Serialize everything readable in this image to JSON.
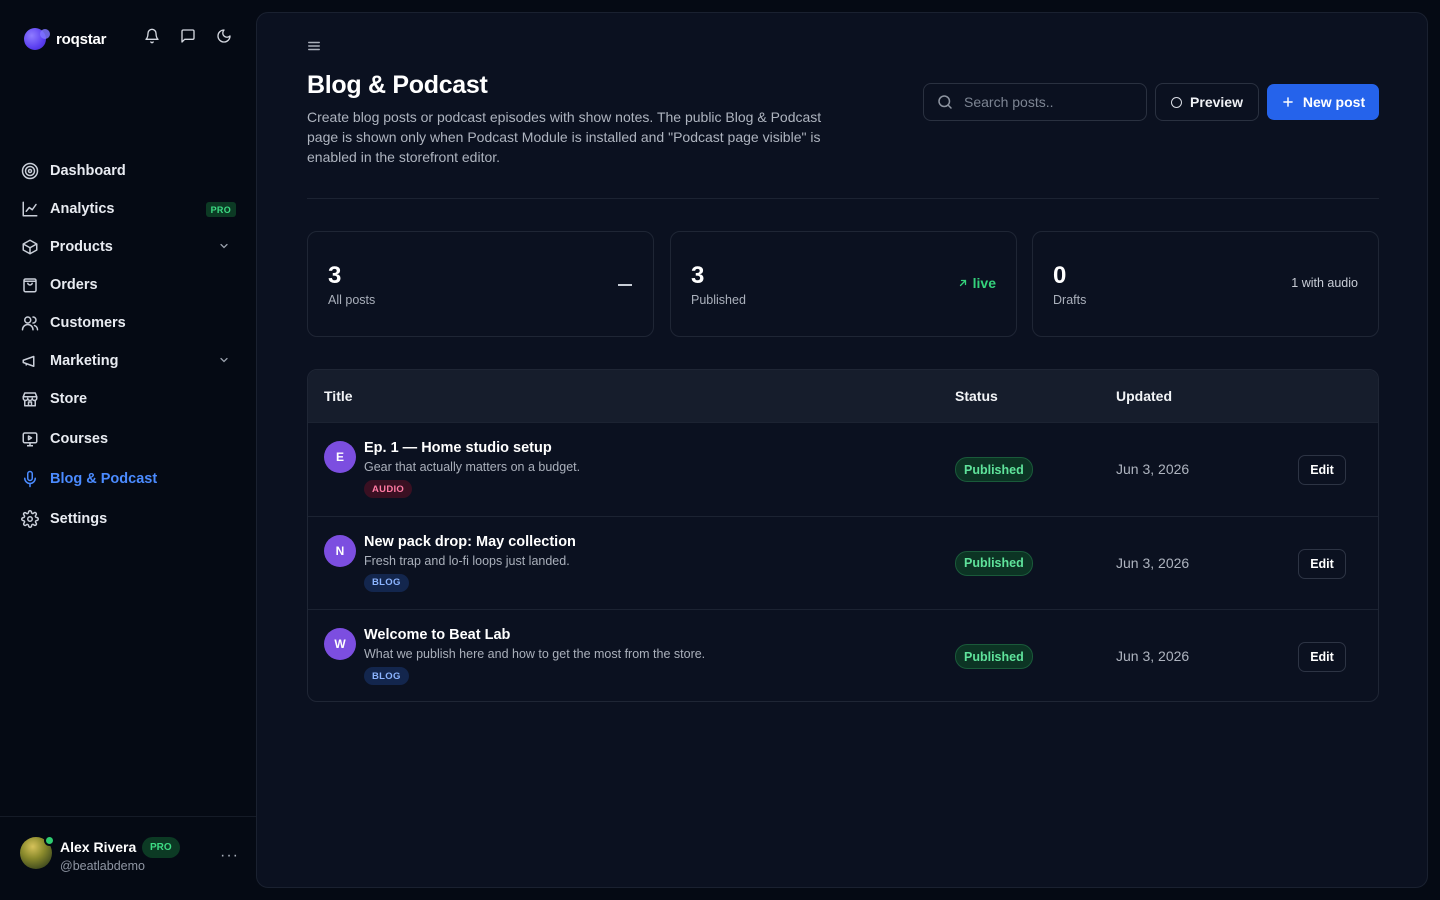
{
  "brand": {
    "name": "roqstar"
  },
  "nav": [
    {
      "label": "Dashboard",
      "icon": "target-icon",
      "active": false
    },
    {
      "label": "Analytics",
      "icon": "chart-line-icon",
      "badge": "PRO"
    },
    {
      "label": "Products",
      "icon": "box-icon",
      "expandable": true
    },
    {
      "label": "Orders",
      "icon": "shopping-bag-icon"
    },
    {
      "label": "Customers",
      "icon": "users-icon"
    },
    {
      "label": "Marketing",
      "icon": "megaphone-icon",
      "expandable": true
    },
    {
      "label": "Store",
      "icon": "storefront-icon"
    },
    {
      "label": "Courses",
      "icon": "presentation-icon"
    },
    {
      "label": "Blog & Podcast",
      "icon": "microphone-icon",
      "active": true
    },
    {
      "label": "Settings",
      "icon": "gear-icon"
    }
  ],
  "user": {
    "name": "Alex Rivera",
    "badge": "PRO",
    "handle": "@beatlabdemo",
    "more": "···"
  },
  "page": {
    "title": "Blog & Podcast",
    "description": "Create blog posts or podcast episodes with show notes. The public Blog & Podcast page is shown only when Podcast Module is installed and \"Podcast page visible\" is enabled in the storefront editor."
  },
  "search": {
    "placeholder": "Search posts.."
  },
  "actions": {
    "preview_label": "Preview",
    "new_post_label": "New post"
  },
  "stats": [
    {
      "value": "3",
      "label": "All posts",
      "aside": ""
    },
    {
      "value": "3",
      "label": "Published",
      "aside": "live"
    },
    {
      "value": "0",
      "label": "Drafts",
      "aside": "1 with audio"
    }
  ],
  "table": {
    "headers": {
      "title": "Title",
      "status": "Status",
      "updated": "Updated"
    },
    "rows": [
      {
        "initial": "E",
        "title": "Ep. 1 — Home studio setup",
        "subtitle": "Gear that actually matters on a budget.",
        "tag": "AUDIO",
        "status": "Published",
        "updated": "Jun 3, 2026",
        "action": "Edit"
      },
      {
        "initial": "N",
        "title": "New pack drop: May collection",
        "subtitle": "Fresh trap and lo-fi loops just landed.",
        "tag": "BLOG",
        "status": "Published",
        "updated": "Jun 3, 2026",
        "action": "Edit"
      },
      {
        "initial": "W",
        "title": "Welcome to Beat Lab",
        "subtitle": "What we publish here and how to get the most from the store.",
        "tag": "BLOG",
        "status": "Published",
        "updated": "Jun 3, 2026",
        "action": "Edit"
      }
    ]
  },
  "colors": {
    "accent": "#2563eb",
    "active_nav": "#4b8bff",
    "success": "#34d27b",
    "audio_tag": "#ff7aa3",
    "blog_tag": "#8cb4ff"
  }
}
